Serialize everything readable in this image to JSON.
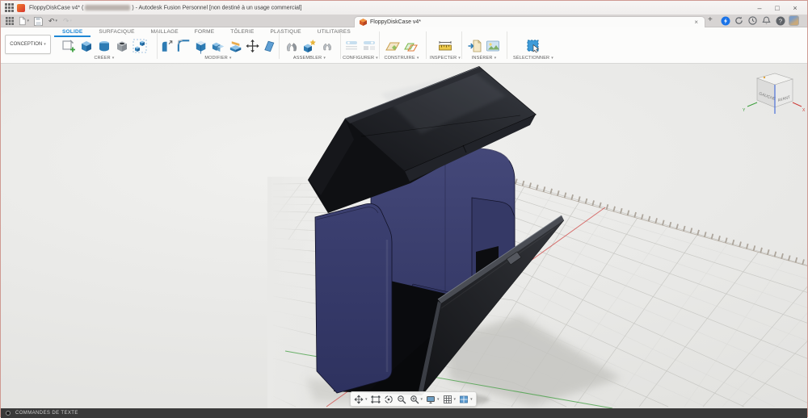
{
  "window": {
    "title_prefix": "FloppyDiskCase v4* (",
    "title_suffix": ") - Autodesk Fusion Personnel [non destiné à un usage commercial]",
    "minimize": "–",
    "maximize": "□",
    "close": "×"
  },
  "tabbar": {
    "tab_label": "FloppyDiskCase v4*",
    "close_tab": "×",
    "new_tab": "+",
    "help": "?"
  },
  "ribbon": {
    "workspace_label": "CONCEPTION",
    "tabs": [
      "SOLIDE",
      "SURFACIQUE",
      "MAILLAGE",
      "FORME",
      "TÔLERIE",
      "PLASTIQUE",
      "UTILITAIRES"
    ],
    "active_tab": "SOLIDE",
    "groups": [
      "CRÉER",
      "MODIFIER",
      "ASSEMBLER",
      "CONFIGURER",
      "CONSTRUIRE",
      "INSPECTER",
      "INSÉRER",
      "SÉLECTIONNER"
    ]
  },
  "viewcube": {
    "left_face": "GAUCHE",
    "front_face": "AVANT",
    "axis_x": "X",
    "axis_y": "Y"
  },
  "statusbar": {
    "label": "COMMANDES DE TEXTE"
  },
  "model": {
    "name": "FloppyDiskCase",
    "body_color": "#3b3f70",
    "lid_color": "#1b1d22",
    "accent_blue": "#0696d7",
    "grid_color": "#c9c9c5",
    "axis_x_color": "#d2504e",
    "axis_y_color": "#3f9e3f"
  }
}
